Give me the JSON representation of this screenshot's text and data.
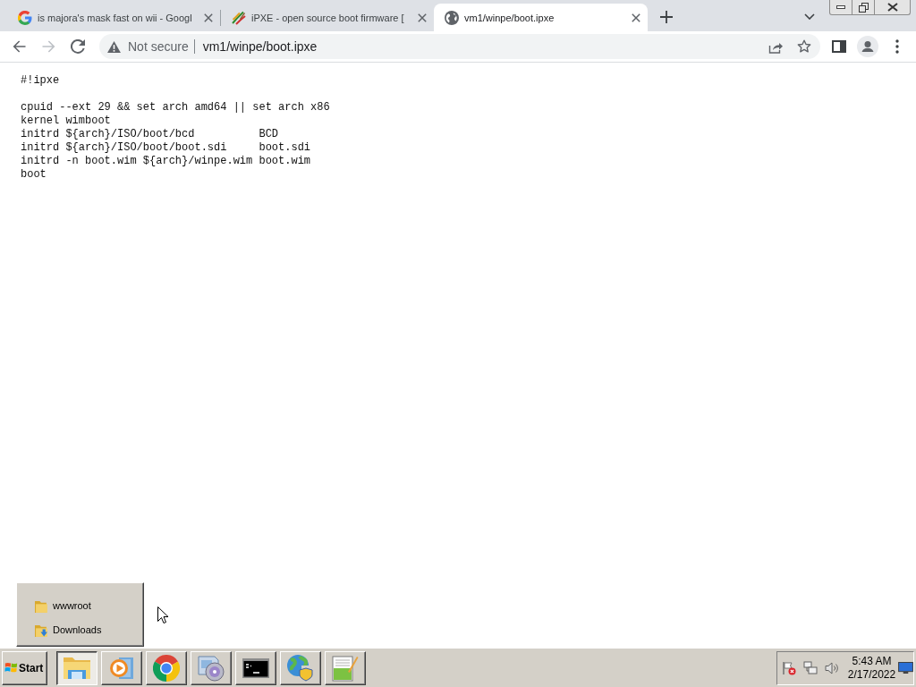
{
  "tabs": [
    {
      "title": "is majora's mask fast on wii - Googl",
      "kind": "search",
      "selected": false
    },
    {
      "title": "iPXE - open source boot firmware [",
      "kind": "ipxe",
      "selected": false
    },
    {
      "title": "vm1/winpe/boot.ipxe",
      "kind": "page",
      "selected": true
    }
  ],
  "nav": [
    {
      "kind": "back",
      "disabled": false
    },
    {
      "kind": "forward",
      "disabled": true
    },
    {
      "kind": "reload",
      "disabled": false
    }
  ],
  "toolbar": {
    "security": "Not secure",
    "url": "vm1/winpe/boot.ipxe"
  },
  "document": {
    "blocks": [
      [
        "#!ipxe"
      ],
      [
        "cpuid --ext 29 && set arch amd64 || set arch x86",
        "kernel wimboot",
        "initrd ${arch}/ISO/boot/bcd          BCD",
        "initrd ${arch}/ISO/boot/boot.sdi     boot.sdi",
        "initrd -n boot.wim ${arch}/winpe.wim boot.wim",
        "boot"
      ]
    ]
  },
  "flyout": {
    "items": [
      {
        "label": "wwwroot",
        "kind": "folder"
      },
      {
        "label": "Downloads",
        "kind": "downloads"
      }
    ]
  },
  "taskbar": {
    "start": "Start",
    "apps": [
      {
        "kind": "explorer",
        "selected": true
      },
      {
        "kind": "media",
        "selected": false
      },
      {
        "kind": "browser",
        "selected": false
      },
      {
        "kind": "disc",
        "selected": false
      },
      {
        "kind": "terminal",
        "selected": false
      },
      {
        "kind": "network",
        "selected": false
      },
      {
        "kind": "editor",
        "selected": false
      }
    ],
    "clock": {
      "time": "5:43 AM",
      "date": "2/17/2022"
    }
  }
}
